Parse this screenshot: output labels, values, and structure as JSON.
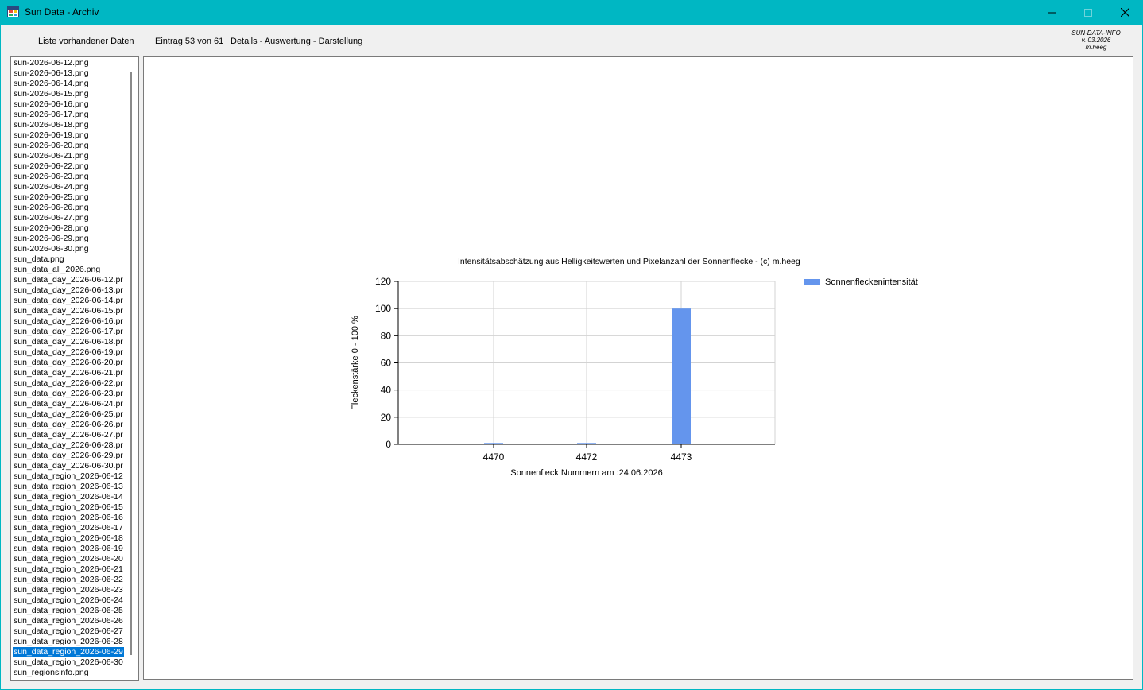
{
  "window": {
    "title": "Sun Data - Archiv",
    "colors": {
      "titlebar": "#00b7c3",
      "selection": "#0078d7",
      "bar": "#6495ed"
    }
  },
  "header": {
    "list_label": "Liste vorhandener Daten",
    "entry_label": "Eintrag 53 von 61",
    "details_label": "Details - Auswertung - Darstellung",
    "info": {
      "line1": "SUN-DATA-INFO",
      "line2": "v. 03.2026",
      "line3": "m.heeg"
    }
  },
  "file_list": {
    "selected_index": 57,
    "items": [
      "sun-2026-06-12.png",
      "sun-2026-06-13.png",
      "sun-2026-06-14.png",
      "sun-2026-06-15.png",
      "sun-2026-06-16.png",
      "sun-2026-06-17.png",
      "sun-2026-06-18.png",
      "sun-2026-06-19.png",
      "sun-2026-06-20.png",
      "sun-2026-06-21.png",
      "sun-2026-06-22.png",
      "sun-2026-06-23.png",
      "sun-2026-06-24.png",
      "sun-2026-06-25.png",
      "sun-2026-06-26.png",
      "sun-2026-06-27.png",
      "sun-2026-06-28.png",
      "sun-2026-06-29.png",
      "sun-2026-06-30.png",
      "sun_data.png",
      "sun_data_all_2026.png",
      "sun_data_day_2026-06-12.pr",
      "sun_data_day_2026-06-13.pr",
      "sun_data_day_2026-06-14.pr",
      "sun_data_day_2026-06-15.pr",
      "sun_data_day_2026-06-16.pr",
      "sun_data_day_2026-06-17.pr",
      "sun_data_day_2026-06-18.pr",
      "sun_data_day_2026-06-19.pr",
      "sun_data_day_2026-06-20.pr",
      "sun_data_day_2026-06-21.pr",
      "sun_data_day_2026-06-22.pr",
      "sun_data_day_2026-06-23.pr",
      "sun_data_day_2026-06-24.pr",
      "sun_data_day_2026-06-25.pr",
      "sun_data_day_2026-06-26.pr",
      "sun_data_day_2026-06-27.pr",
      "sun_data_day_2026-06-28.pr",
      "sun_data_day_2026-06-29.pr",
      "sun_data_day_2026-06-30.pr",
      "sun_data_region_2026-06-12",
      "sun_data_region_2026-06-13",
      "sun_data_region_2026-06-14",
      "sun_data_region_2026-06-15",
      "sun_data_region_2026-06-16",
      "sun_data_region_2026-06-17",
      "sun_data_region_2026-06-18",
      "sun_data_region_2026-06-19",
      "sun_data_region_2026-06-20",
      "sun_data_region_2026-06-21",
      "sun_data_region_2026-06-22",
      "sun_data_region_2026-06-23",
      "sun_data_region_2026-06-24",
      "sun_data_region_2026-06-25",
      "sun_data_region_2026-06-26",
      "sun_data_region_2026-06-27",
      "sun_data_region_2026-06-28",
      "sun_data_region_2026-06-29",
      "sun_data_region_2026-06-30",
      "sun_regionsinfo.png"
    ]
  },
  "chart_data": {
    "type": "bar",
    "title": "Intensitätsabschätzung aus Helligkeitswerten und Pixelanzahl der Sonnenflecke - (c) m.heeg",
    "xlabel": "Sonnenfleck Nummern am :24.06.2026",
    "ylabel": "Fleckenstärke  0 - 100 %",
    "categories": [
      "4470",
      "4472",
      "4473"
    ],
    "series": [
      {
        "name": "Sonnenfleckenintensität",
        "values": [
          1,
          1,
          100
        ]
      }
    ],
    "ylim": [
      0,
      120
    ],
    "yticks": [
      0,
      20,
      40,
      60,
      80,
      100,
      120
    ],
    "grid": true,
    "legend": "top-right"
  }
}
